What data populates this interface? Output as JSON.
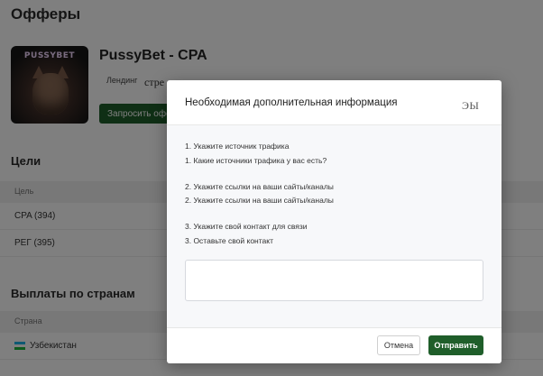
{
  "page": {
    "title": "Офферы",
    "offer": {
      "thumbnail_logo": "PUSSYBET",
      "name": "PussyBet - CPA",
      "landing_label": "Лендинг",
      "landing_value": "стре",
      "request_button": "Запросить офе"
    },
    "goals": {
      "title": "Цели",
      "column": "Цель",
      "rows": [
        "CPA (394)",
        "РЕГ (395)"
      ]
    },
    "payouts": {
      "title": "Выплаты по странам",
      "column": "Страна",
      "rows": [
        {
          "country": "Узбекистан",
          "flag": "uzbekistan-flag-icon"
        }
      ]
    }
  },
  "modal": {
    "title": "Необходимая дополнительная информация",
    "close_label": "ЭЫ",
    "questions": [
      "1. Укажите источник трафика",
      "1. Какие источники трафика у вас есть?",
      "2. Укажите ссылки на ваши сайты/каналы",
      "2. Укажите ссылки на ваши сайты/каналы",
      "3. Укажите свой контакт для связи",
      "3. Оставьте свой контакт"
    ],
    "answer_value": "",
    "cancel_label": "Отмена",
    "submit_label": "Отправить"
  },
  "colors": {
    "accent_green": "#1f5e2a",
    "overlay": "rgba(0,0,0,0.5)"
  }
}
